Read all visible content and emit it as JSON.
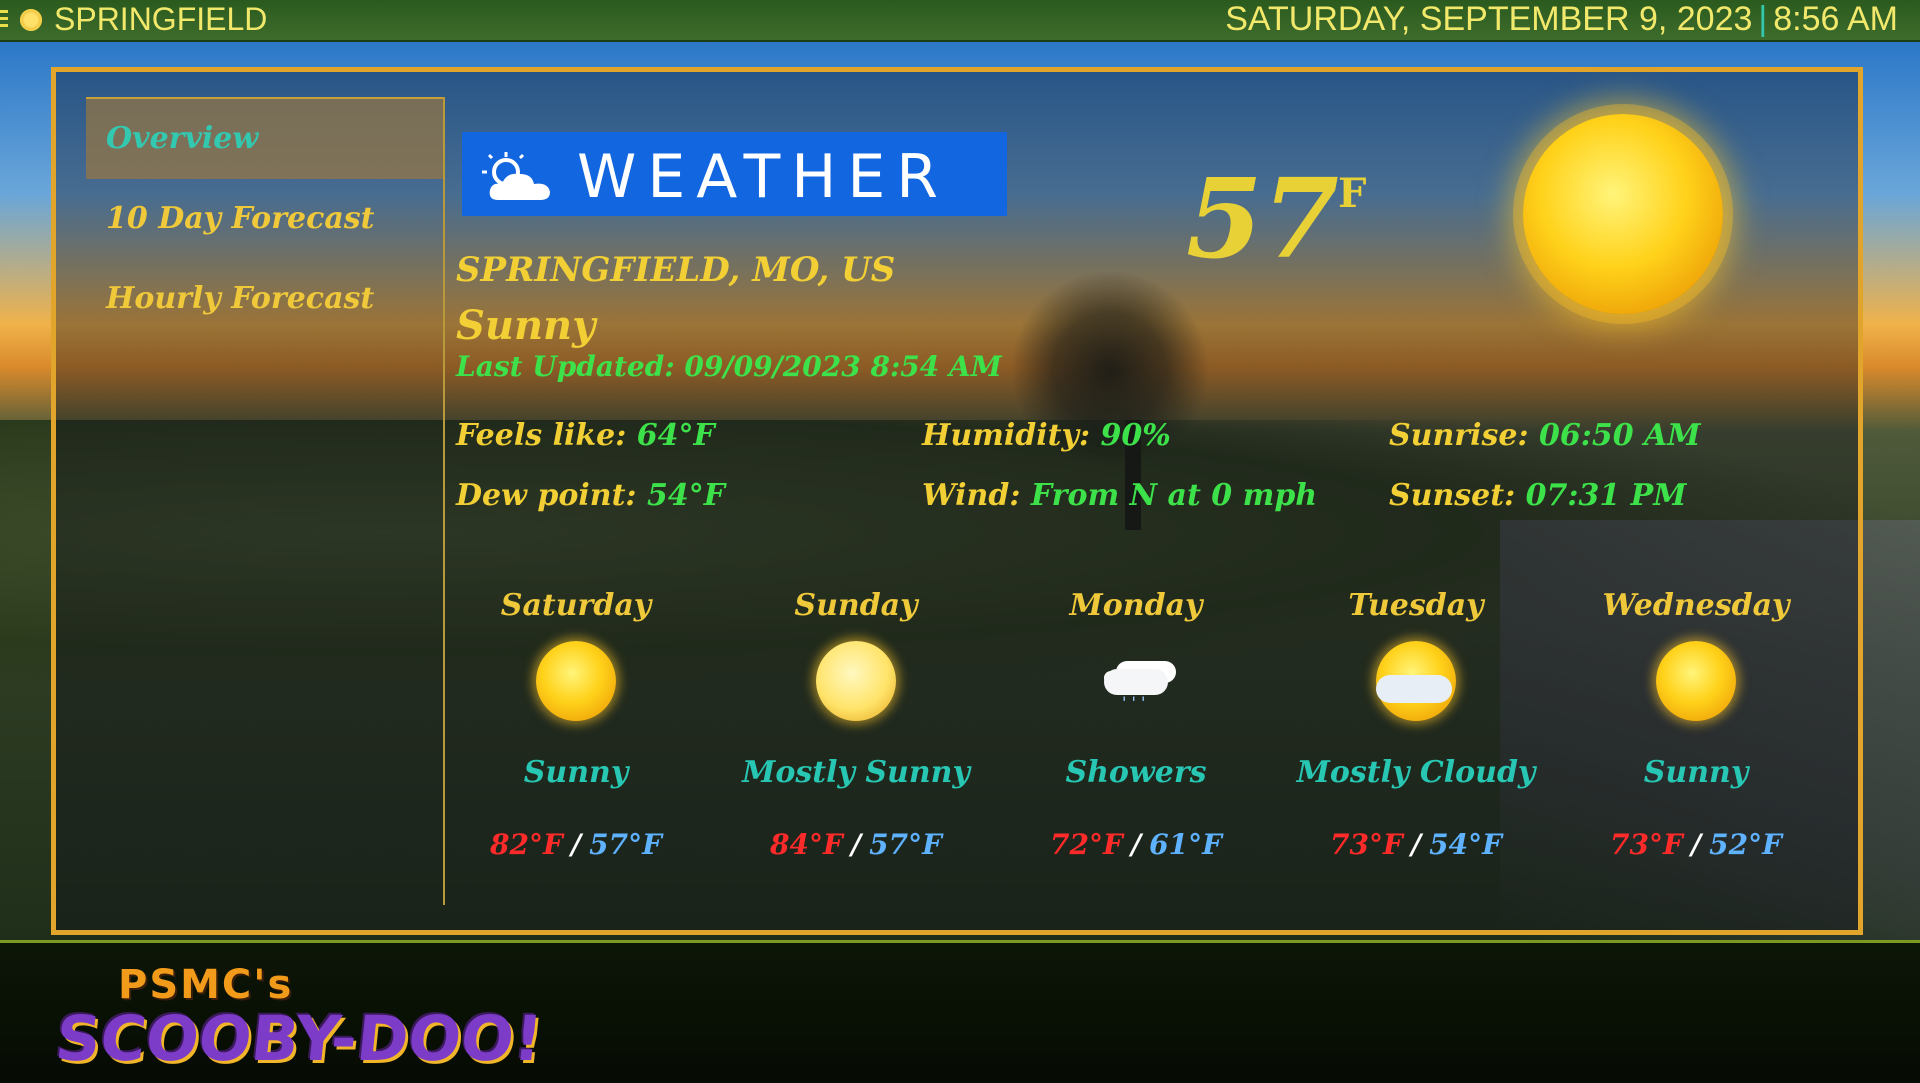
{
  "top_bar": {
    "app_title": "SPRINGFIELD",
    "date": "SATURDAY, SEPTEMBER 9, 2023",
    "separator": "|",
    "time": "8:56 AM"
  },
  "sidebar": {
    "items": [
      {
        "label": "Overview",
        "active": true
      },
      {
        "label": "10 Day Forecast",
        "active": false
      },
      {
        "label": "Hourly Forecast",
        "active": false
      }
    ]
  },
  "weather_badge": {
    "title": "WEATHER",
    "icon": "partly-cloudy-icon"
  },
  "current": {
    "location": "SPRINGFIELD, MO, US",
    "condition": "Sunny",
    "last_updated": "Last Updated: 09/09/2023 8:54 AM",
    "temperature": "57",
    "unit": "°F",
    "icon": "sun-icon"
  },
  "stats": {
    "feels_like": {
      "label": "Feels like: ",
      "value": "64°F"
    },
    "dew_point": {
      "label": "Dew point: ",
      "value": "54°F"
    },
    "humidity": {
      "label": "Humidity: ",
      "value": "90%"
    },
    "wind": {
      "label": "Wind: ",
      "value": "From N at 0 mph"
    },
    "sunrise": {
      "label": "Sunrise: ",
      "value": "06:50 AM"
    },
    "sunset": {
      "label": "Sunset: ",
      "value": "07:31 PM"
    }
  },
  "forecast": [
    {
      "day": "Saturday",
      "condition": "Sunny",
      "high": "82°F",
      "low": "57°F",
      "icon": "sun-icon"
    },
    {
      "day": "Sunday",
      "condition": "Mostly Sunny",
      "high": "84°F",
      "low": "57°F",
      "icon": "mostly-sunny-icon"
    },
    {
      "day": "Monday",
      "condition": "Showers",
      "high": "72°F",
      "low": "61°F",
      "icon": "showers-icon"
    },
    {
      "day": "Tuesday",
      "condition": "Mostly Cloudy",
      "high": "73°F",
      "low": "54°F",
      "icon": "mostly-cloudy-icon"
    },
    {
      "day": "Wednesday",
      "condition": "Sunny",
      "high": "73°F",
      "low": "52°F",
      "icon": "sun-icon"
    }
  ],
  "temp_separator": "/",
  "logo": {
    "line1": "PSMC's",
    "line2": "SCOOBY-DOO!"
  },
  "colors": {
    "panel_border": "#e0a52a",
    "badge": "#1267e0",
    "label_yellow": "#f2cf34",
    "value_green": "#3de24a",
    "high_red": "#ff2a2a",
    "low_blue": "#5fb2ff",
    "condition_teal": "#27c7b4"
  }
}
